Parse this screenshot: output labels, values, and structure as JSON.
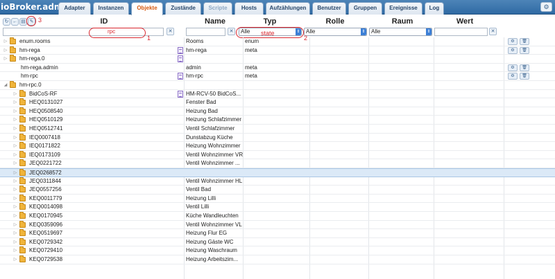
{
  "app": {
    "title": "ioBroker.admin"
  },
  "tabs": [
    {
      "label": "Adapter",
      "state": "normal"
    },
    {
      "label": "Instanzen",
      "state": "normal"
    },
    {
      "label": "Objekte",
      "state": "active"
    },
    {
      "label": "Zustände",
      "state": "normal"
    },
    {
      "label": "Scripte",
      "state": "disabled"
    },
    {
      "label": "Hosts",
      "state": "normal"
    },
    {
      "label": "Aufzählungen",
      "state": "normal"
    },
    {
      "label": "Benutzer",
      "state": "normal"
    },
    {
      "label": "Gruppen",
      "state": "normal"
    },
    {
      "label": "Ereignisse",
      "state": "normal"
    },
    {
      "label": "Log",
      "state": "normal"
    }
  ],
  "toolbar": {
    "icons": [
      "refresh-icon",
      "back-icon",
      "folder-icon",
      "edit-icon"
    ],
    "settings_icon": "gear-icon"
  },
  "columns": {
    "id": "ID",
    "name": "Name",
    "type": "Typ",
    "role": "Rolle",
    "room": "Raum",
    "value": "Wert"
  },
  "filters": {
    "id_value": "rpc",
    "name_value": "",
    "type_selected": "Alle",
    "role_selected": "Alle",
    "room_selected": "Alle",
    "value_value": ""
  },
  "annotations": {
    "label_1": "1",
    "label_2": "2",
    "label_3": "3",
    "type_hint": "state"
  },
  "rows": [
    {
      "id": "enum.rooms",
      "indent": 0,
      "expander": "▷",
      "folder": true,
      "doc": false,
      "name": "Rooms",
      "type": "enum",
      "selected": false,
      "actions": true
    },
    {
      "id": "hm-rega",
      "indent": 0,
      "expander": "▷",
      "folder": true,
      "doc": true,
      "name": "hm-rega",
      "type": "meta",
      "selected": false,
      "actions": true
    },
    {
      "id": "hm-rega.0",
      "indent": 0,
      "expander": "▷",
      "folder": true,
      "doc": true,
      "name": "",
      "type": "",
      "selected": false,
      "actions": false
    },
    {
      "id": "hm-rega.admin",
      "indent": 0,
      "expander": "",
      "folder": false,
      "doc": false,
      "name": "admin",
      "type": "meta",
      "selected": false,
      "actions": true
    },
    {
      "id": "hm-rpc",
      "indent": 0,
      "expander": "",
      "folder": false,
      "doc": true,
      "name": "hm-rpc",
      "type": "meta",
      "selected": false,
      "actions": true
    },
    {
      "id": "hm-rpc.0",
      "indent": 0,
      "expander": "◢",
      "folder": true,
      "doc": false,
      "name": "",
      "type": "",
      "selected": false,
      "actions": false
    },
    {
      "id": "BidCoS-RF",
      "indent": 1,
      "expander": "▷",
      "folder": true,
      "doc": true,
      "name": "HM-RCV-50 BidCoS...",
      "type": "",
      "selected": false,
      "actions": false
    },
    {
      "id": "HEQ0131027",
      "indent": 1,
      "expander": "▷",
      "folder": true,
      "doc": false,
      "name": "Fenster Bad",
      "type": "",
      "selected": false,
      "actions": false
    },
    {
      "id": "HEQ0508540",
      "indent": 1,
      "expander": "▷",
      "folder": true,
      "doc": false,
      "name": "Heizung Bad",
      "type": "",
      "selected": false,
      "actions": false
    },
    {
      "id": "HEQ0510129",
      "indent": 1,
      "expander": "▷",
      "folder": true,
      "doc": false,
      "name": "Heizung Schlafzimmer",
      "type": "",
      "selected": false,
      "actions": false
    },
    {
      "id": "HEQ0512741",
      "indent": 1,
      "expander": "▷",
      "folder": true,
      "doc": false,
      "name": "Ventil Schlafzimmer",
      "type": "",
      "selected": false,
      "actions": false
    },
    {
      "id": "IEQ0007418",
      "indent": 1,
      "expander": "▷",
      "folder": true,
      "doc": false,
      "name": "Dunstabzug Küche",
      "type": "",
      "selected": false,
      "actions": false
    },
    {
      "id": "IEQ0171822",
      "indent": 1,
      "expander": "▷",
      "folder": true,
      "doc": false,
      "name": "Heizung Wohnzimmer",
      "type": "",
      "selected": false,
      "actions": false
    },
    {
      "id": "IEQ0173109",
      "indent": 1,
      "expander": "▷",
      "folder": true,
      "doc": false,
      "name": "Ventil Wohnzimmer VR",
      "type": "",
      "selected": false,
      "actions": false
    },
    {
      "id": "JEQ0221722",
      "indent": 1,
      "expander": "▷",
      "folder": true,
      "doc": false,
      "name": "Ventil Wohnzimmer ...",
      "type": "",
      "selected": false,
      "actions": false
    },
    {
      "id": "JEQ0268572",
      "indent": 1,
      "expander": "▷",
      "folder": true,
      "doc": false,
      "name": "",
      "type": "",
      "selected": true,
      "actions": false
    },
    {
      "id": "JEQ0311844",
      "indent": 1,
      "expander": "▷",
      "folder": true,
      "doc": false,
      "name": "Ventil Wohnzimmer HL",
      "type": "",
      "selected": false,
      "actions": false
    },
    {
      "id": "JEQ0557256",
      "indent": 1,
      "expander": "▷",
      "folder": true,
      "doc": false,
      "name": "Ventil Bad",
      "type": "",
      "selected": false,
      "actions": false
    },
    {
      "id": "KEQ0011779",
      "indent": 1,
      "expander": "▷",
      "folder": true,
      "doc": false,
      "name": "Heizung Lilli",
      "type": "",
      "selected": false,
      "actions": false
    },
    {
      "id": "KEQ0014098",
      "indent": 1,
      "expander": "▷",
      "folder": true,
      "doc": false,
      "name": "Ventil Lilli",
      "type": "",
      "selected": false,
      "actions": false
    },
    {
      "id": "KEQ0170945",
      "indent": 1,
      "expander": "▷",
      "folder": true,
      "doc": false,
      "name": "Küche Wandleuchten",
      "type": "",
      "selected": false,
      "actions": false
    },
    {
      "id": "KEQ0359096",
      "indent": 1,
      "expander": "▷",
      "folder": true,
      "doc": false,
      "name": "Ventil Wohnzimmer VL",
      "type": "",
      "selected": false,
      "actions": false
    },
    {
      "id": "KEQ0519697",
      "indent": 1,
      "expander": "▷",
      "folder": true,
      "doc": false,
      "name": "Heizung Flur EG",
      "type": "",
      "selected": false,
      "actions": false
    },
    {
      "id": "KEQ0729342",
      "indent": 1,
      "expander": "▷",
      "folder": true,
      "doc": false,
      "name": "Heizung Gäste WC",
      "type": "",
      "selected": false,
      "actions": false
    },
    {
      "id": "KEQ0729410",
      "indent": 1,
      "expander": "▷",
      "folder": true,
      "doc": false,
      "name": "Heizung Waschraum",
      "type": "",
      "selected": false,
      "actions": false
    },
    {
      "id": "KEQ0729538",
      "indent": 1,
      "expander": "▷",
      "folder": true,
      "doc": false,
      "name": "Heizung Arbeitszim...",
      "type": "",
      "selected": false,
      "actions": false
    }
  ]
}
